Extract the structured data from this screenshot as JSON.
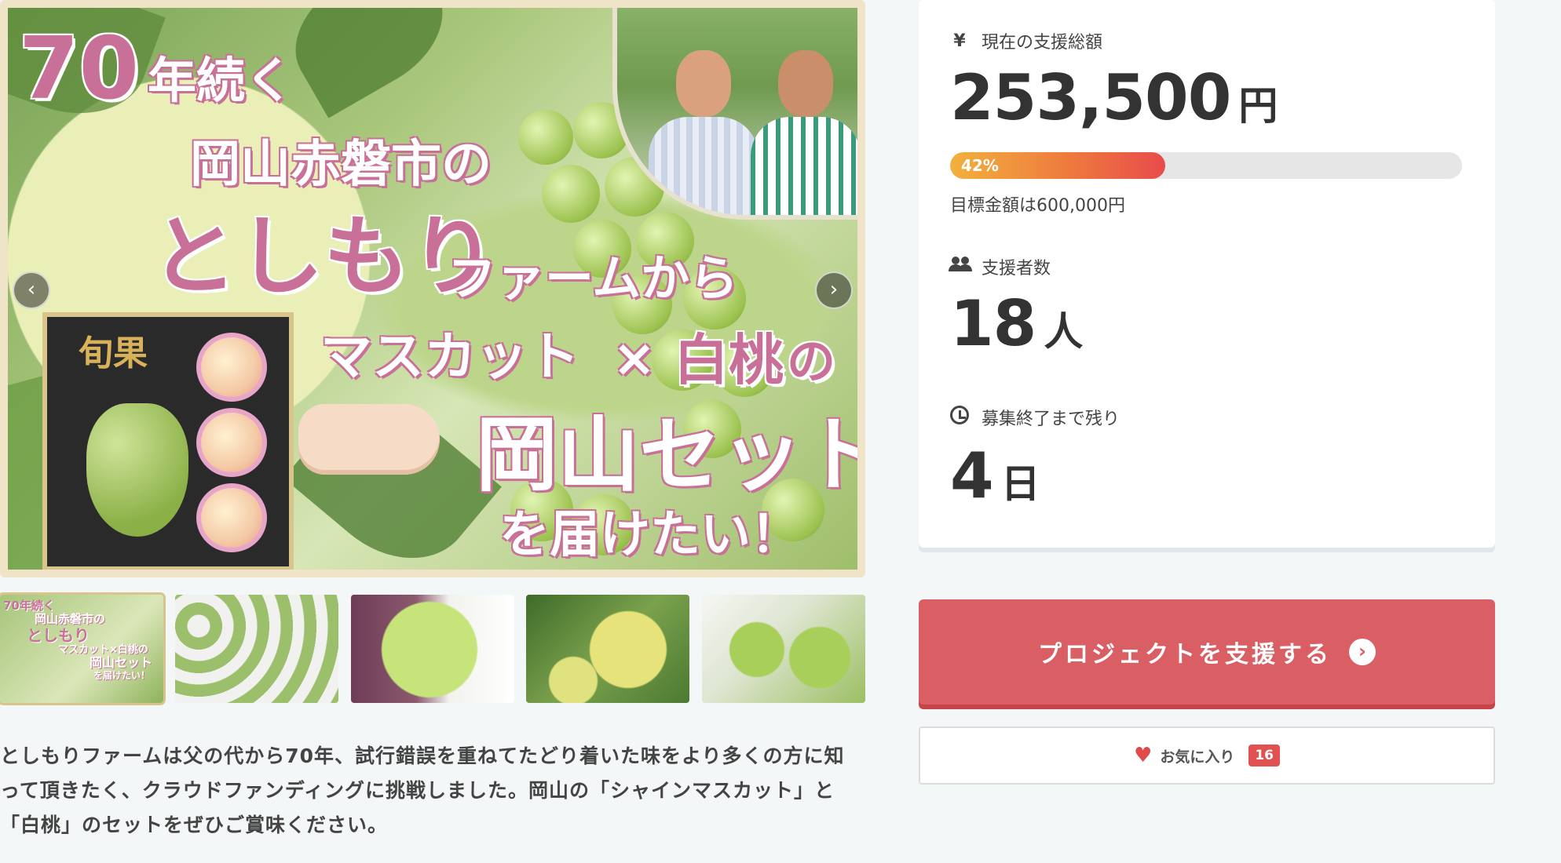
{
  "hero": {
    "line1_num": "70",
    "line1_rest": "年続く",
    "line2": "岡山赤磐市の",
    "line3": "としもり",
    "line3_rest": "ファームから",
    "line4_a": "マスカット",
    "line4_x": "×",
    "line4_b": "白桃",
    "line4_c": "の",
    "line5": "岡山セット",
    "line6": "を届けたい！",
    "box_mark": "旬果",
    "prev_icon": "‹",
    "next_icon": "›"
  },
  "description": "としもりファームは父の代から70年、試行錯誤を重ねてたどり着いた味をより多くの方に知って頂きたく、クラウドファンディングに挑戦しました。岡山の「シャインマスカット」と「白桃」のセットをぜひご賞味ください。",
  "stats": {
    "total_label": "現在の支援総額",
    "total_icon": "¥",
    "total_value": "253,500",
    "total_unit": "円",
    "progress_percent": 42,
    "progress_label": "42%",
    "goal_text": "目標金額は600,000円",
    "backers_label": "支援者数",
    "backers_value": "18",
    "backers_unit": "人",
    "remaining_label": "募集終了まで残り",
    "remaining_value": "4",
    "remaining_unit": "日"
  },
  "actions": {
    "support_label": "プロジェクトを支援する",
    "support_icon": "›",
    "favorite_icon": "♥",
    "favorite_label": "お気に入り",
    "favorite_count": "16"
  },
  "thumbnail_mini": {
    "t1": "70年続く",
    "t2": "岡山赤磐市の",
    "t3": "としもり",
    "t4": "マスカット×白桃の",
    "t5": "岡山セット",
    "t6": "を届けたい！"
  },
  "colors": {
    "accent": "#d95f64",
    "pink_text": "#c97098",
    "progress_start": "#f2b13e",
    "progress_end": "#e84b4b"
  }
}
